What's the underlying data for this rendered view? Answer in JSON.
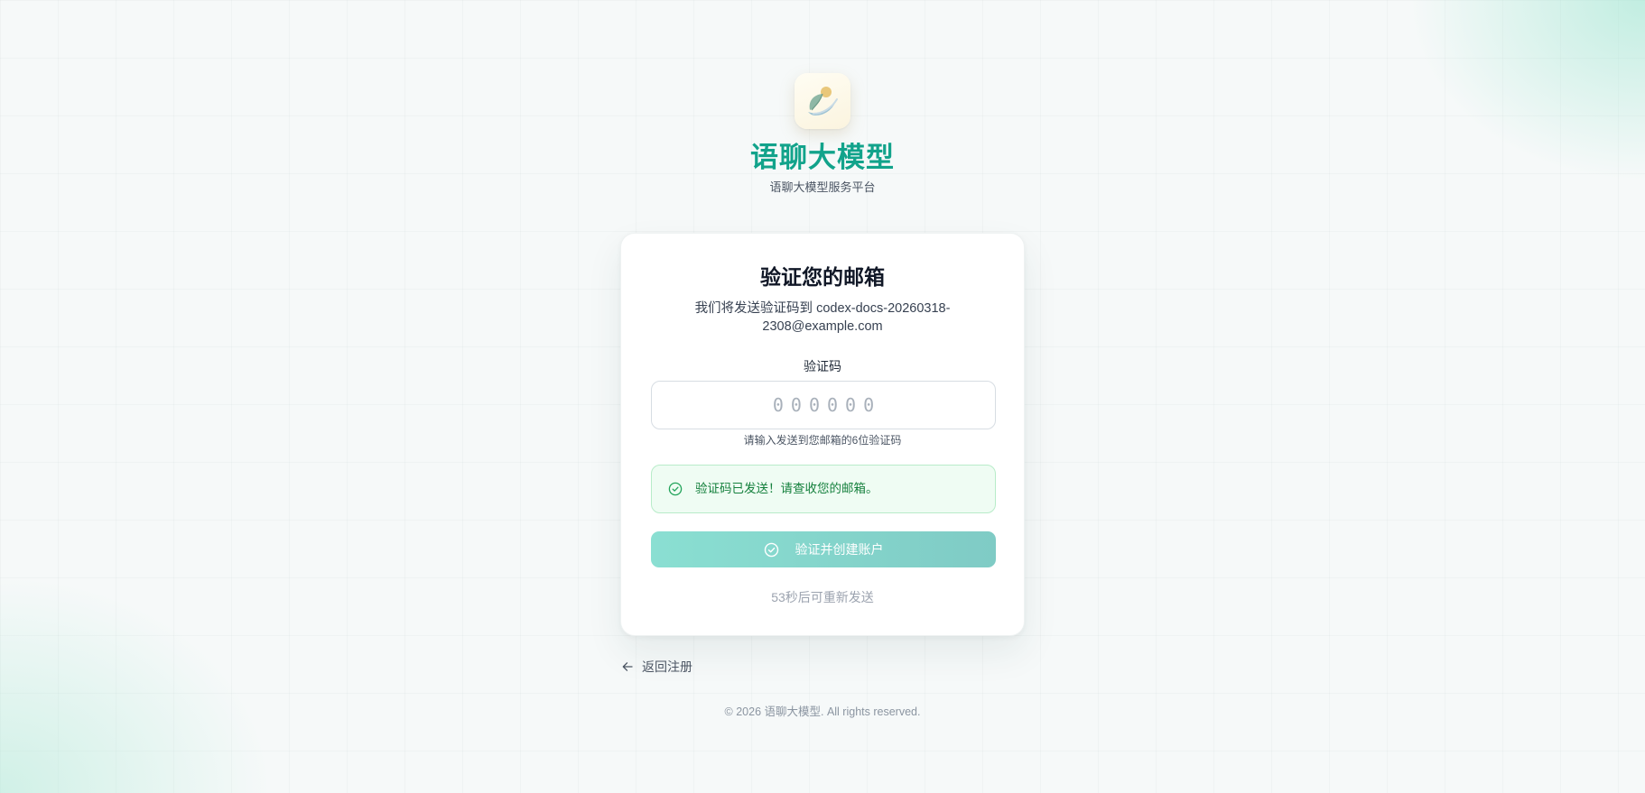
{
  "brand": {
    "logo_icon": "leaf-sun-logo-icon",
    "title": "语聊大模型",
    "subtitle": "语聊大模型服务平台",
    "accent_color": "#12a38b"
  },
  "verify_card": {
    "title": "验证您的邮箱",
    "description": "我们将发送验证码到 codex-docs-20260318-2308@example.com",
    "code_field": {
      "label": "验证码",
      "placeholder": "000000",
      "value": "",
      "hint": "请输入发送到您邮箱的6位验证码"
    },
    "alert": {
      "icon": "check-circle-icon",
      "text": "验证码已发送！请查收您的邮箱。",
      "color": "#15803d"
    },
    "submit_button": {
      "icon": "check-circle-icon",
      "label": "验证并创建账户",
      "state": "disabled"
    },
    "resend_text": "53秒后可重新发送"
  },
  "back_link": {
    "icon": "arrow-left-icon",
    "label": "返回注册"
  },
  "footer": {
    "copyright": "© 2026 语聊大模型. All rights reserved."
  }
}
